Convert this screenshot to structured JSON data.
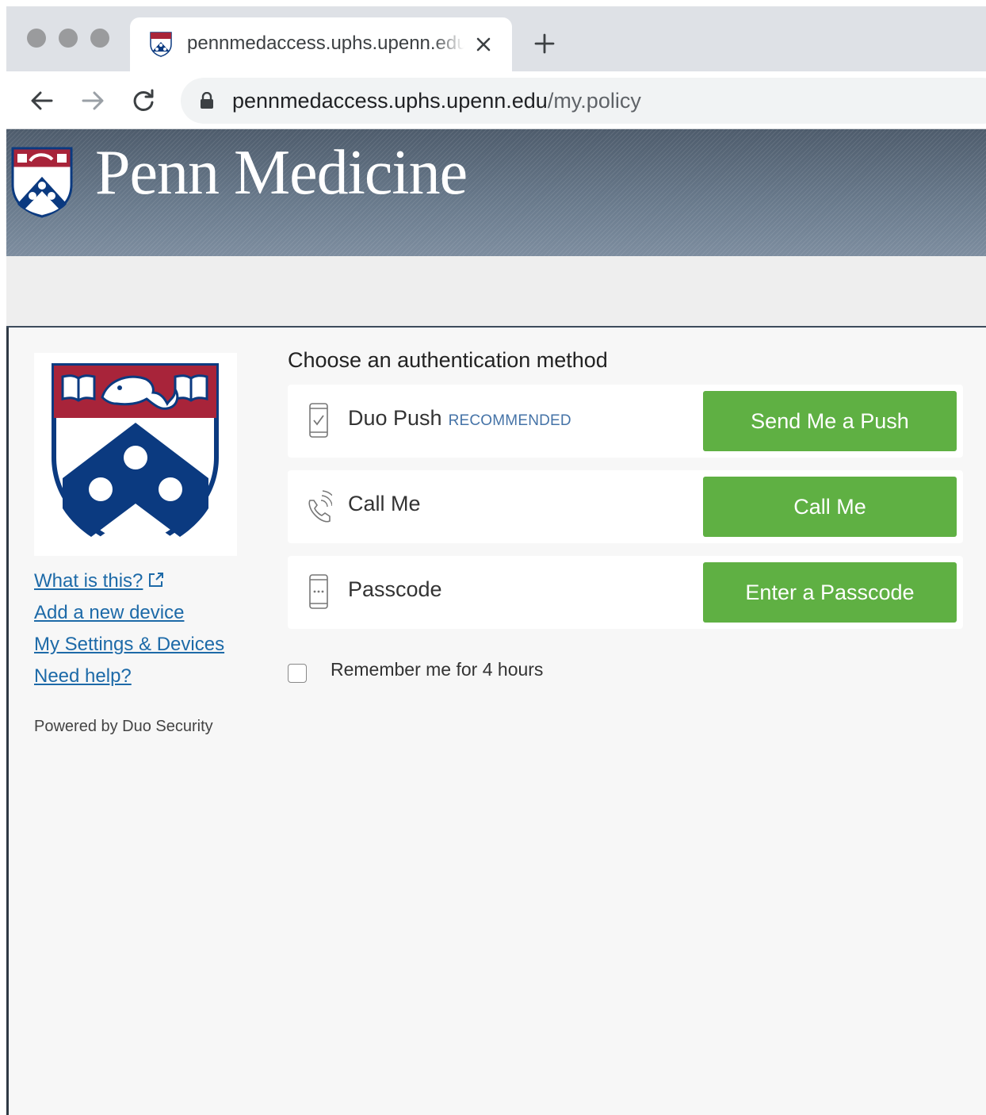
{
  "browser": {
    "tab": {
      "title": "pennmedaccess.uphs.upenn.edu"
    },
    "url": {
      "domain": "pennmedaccess.uphs.upenn.edu",
      "path": "/my.policy"
    }
  },
  "banner": {
    "title": "Penn Medicine"
  },
  "duo": {
    "prompt": "Choose an authentication method",
    "methods": [
      {
        "label": "Duo Push",
        "badge": "RECOMMENDED",
        "button": "Send Me a Push",
        "icon": "phone-check-icon"
      },
      {
        "label": "Call Me",
        "button": "Call Me",
        "icon": "phone-ring-icon"
      },
      {
        "label": "Passcode",
        "button": "Enter a Passcode",
        "icon": "phone-passcode-icon"
      }
    ],
    "remember_label": "Remember me for 4 hours",
    "remember_checked": false,
    "links": [
      "What is this?",
      "Add a new device",
      "My Settings & Devices",
      "Need help?"
    ],
    "powered_by": "Powered by Duo Security"
  },
  "colors": {
    "button": "#5fb043",
    "link": "#1d6aa8",
    "penn_red": "#a8243a",
    "penn_blue": "#0b3a80",
    "banner": "#5d6c7c"
  }
}
